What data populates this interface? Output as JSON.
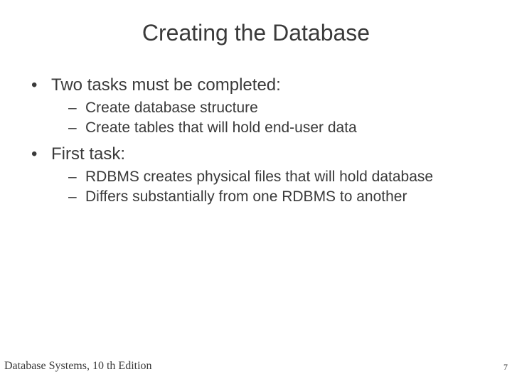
{
  "title": "Creating the Database",
  "bullets": [
    {
      "text": "Two tasks must be completed:",
      "sub": [
        "Create database structure",
        "Create tables that will hold end-user data"
      ]
    },
    {
      "text": "First task:",
      "sub": [
        "RDBMS creates physical files that will hold database",
        "Differs substantially from one RDBMS to another"
      ]
    }
  ],
  "footer_left": "Database Systems, 10 th Edition",
  "footer_right": "7"
}
